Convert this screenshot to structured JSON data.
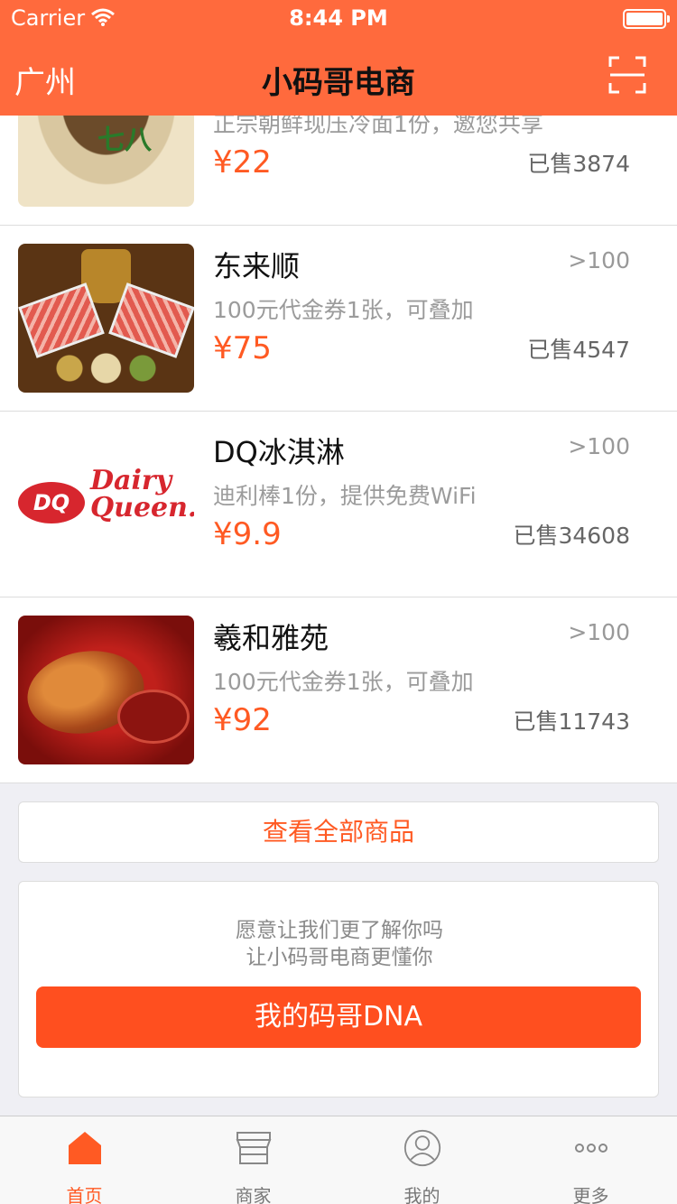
{
  "status_bar": {
    "carrier": "Carrier",
    "time": "8:44 PM"
  },
  "nav": {
    "city": "广州",
    "title": "小码哥电商"
  },
  "products": [
    {
      "name": "",
      "description": "正宗朝鲜现压冷面1份，邀您共享",
      "price": "¥22",
      "sold": "已售3874",
      "distance": ""
    },
    {
      "name": "东来顺",
      "description": "100元代金券1张，可叠加",
      "price": "¥75",
      "sold": "已售4547",
      "distance": ">100"
    },
    {
      "name": "DQ冰淇淋",
      "description": "迪利棒1份，提供免费WiFi",
      "price": "¥9.9",
      "sold": "已售34608",
      "distance": ">100"
    },
    {
      "name": "羲和雅苑",
      "description": "100元代金券1张，可叠加",
      "price": "¥92",
      "sold": "已售11743",
      "distance": ">100"
    }
  ],
  "images": {
    "noodle_logo": "七八",
    "dq_badge": "DQ",
    "dq_brand_1": "Dairy",
    "dq_brand_2": "Queen."
  },
  "view_all_label": "查看全部商品",
  "dna_card": {
    "line1": "愿意让我们更了解你吗",
    "line2": "让小码哥电商更懂你",
    "button": "我的码哥DNA"
  },
  "tabs": [
    {
      "label": "首页",
      "icon": "home-icon",
      "active": true
    },
    {
      "label": "商家",
      "icon": "store-icon",
      "active": false
    },
    {
      "label": "我的",
      "icon": "profile-icon",
      "active": false
    },
    {
      "label": "更多",
      "icon": "more-icon",
      "active": false
    }
  ],
  "colors": {
    "accent": "#ff6a3d",
    "price": "#ff5a23",
    "button": "#ff4f1f"
  }
}
